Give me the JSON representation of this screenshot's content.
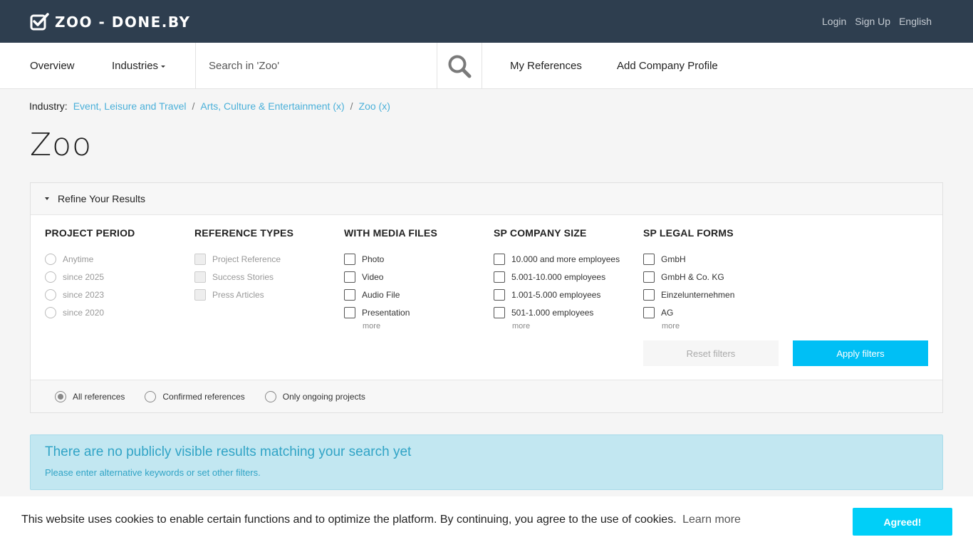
{
  "header": {
    "logo_text": "ZOO - DONE.BY",
    "links": [
      "Login",
      "Sign Up",
      "English"
    ]
  },
  "nav": {
    "overview": "Overview",
    "industries": "Industries",
    "search_placeholder": "Search in 'Zoo'",
    "my_references": "My References",
    "add_company_profile": "Add Company Profile"
  },
  "breadcrumb": {
    "prefix": "Industry:",
    "items": [
      "Event, Leisure and Travel",
      "Arts, Culture & Entertainment (x)",
      "Zoo (x)"
    ]
  },
  "page_title": "Zoo",
  "refine": {
    "title": "Refine Your Results",
    "columns": [
      {
        "title": "PROJECT PERIOD",
        "options": [
          "Anytime",
          "since 2025",
          "since 2023",
          "since 2020"
        ]
      },
      {
        "title": "REFERENCE TYPES",
        "options": [
          "Project Reference",
          "Success Stories",
          "Press Articles"
        ]
      },
      {
        "title": "WITH MEDIA FILES",
        "options": [
          "Photo",
          "Video",
          "Audio File",
          "Presentation"
        ],
        "more": "more"
      },
      {
        "title": "SP COMPANY SIZE",
        "options": [
          "10.000 and more employees",
          "5.001-10.000 employees",
          "1.001-5.000 employees",
          "501-1.000 employees"
        ],
        "more": "more"
      },
      {
        "title": "SP LEGAL FORMS",
        "options": [
          "GmbH",
          "GmbH & Co. KG",
          "Einzelunternehmen",
          "AG"
        ],
        "more": "more"
      }
    ],
    "reset_label": "Reset filters",
    "apply_label": "Apply filters",
    "scope_options": [
      "All references",
      "Confirmed references",
      "Only ongoing projects"
    ],
    "scope_selected": "All references"
  },
  "alert": {
    "title": "There are no publicly visible results matching your search yet",
    "text": "Please enter alternative keywords or set other filters."
  },
  "cookie": {
    "text": "This website uses cookies to enable certain functions and to optimize the platform. By continuing, you agree to the use of cookies.",
    "learn_more": "Learn more",
    "button": "Agreed!"
  },
  "colors": {
    "header_bg": "#2e3e4f",
    "link": "#4ab0d9",
    "primary_button": "#00bff5",
    "alert_bg": "#c2e7f1",
    "alert_text": "#31a4c6",
    "cookie_button": "#00cff8"
  }
}
